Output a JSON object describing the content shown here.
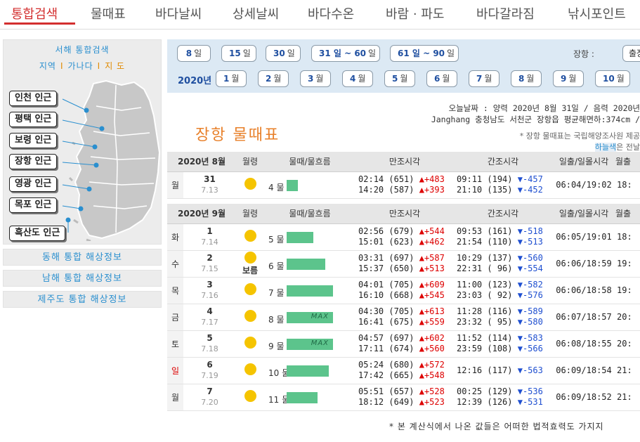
{
  "nav": {
    "tabs": [
      "통합검색",
      "물때표",
      "바다날씨",
      "상세날씨",
      "바다수온",
      "바람 · 파도",
      "바다갈라짐",
      "낚시포인트"
    ]
  },
  "sidebar": {
    "west_title": "서해 통합검색",
    "links": [
      "지역",
      "가나다",
      "지 도"
    ],
    "regions": [
      "인천 인근",
      "평택 인근",
      "보령 인근",
      "장항 인근",
      "영광 인근",
      "목포 인근",
      "흑산도 인근"
    ],
    "other": [
      "동해 통합 해상정보",
      "남해 통합 해상정보",
      "제주도 통합 해상정보"
    ]
  },
  "controls": {
    "ranges": [
      {
        "n": "8",
        "u": "일"
      },
      {
        "n": "15",
        "u": "일"
      },
      {
        "n": "30",
        "u": "일"
      },
      {
        "n": "31 일 ~ 60",
        "u": "일"
      },
      {
        "n": "61 일 ~ 90",
        "u": "일"
      }
    ],
    "year": "2020년",
    "months": [
      {
        "n": "1",
        "u": "월"
      },
      {
        "n": "2",
        "u": "월"
      },
      {
        "n": "3",
        "u": "월"
      },
      {
        "n": "4",
        "u": "월"
      },
      {
        "n": "5",
        "u": "월"
      },
      {
        "n": "6",
        "u": "월"
      },
      {
        "n": "7",
        "u": "월"
      },
      {
        "n": "8",
        "u": "월"
      },
      {
        "n": "9",
        "u": "월"
      },
      {
        "n": "10",
        "u": "월"
      }
    ],
    "port_label": "장항 :",
    "port_value": "출장"
  },
  "info": {
    "date_line": "오늘날짜 : 양력 2020년 8월 31일 / 음력 2020년",
    "place_line": "Janghang 충청남도 서천군 장항읍 평균해면하:374cm /",
    "note1": "* 장항 물때표는 국립해양조사원 제공",
    "note2_hl": "하늘색",
    "note2_rest": "은 전날"
  },
  "title": "장항 물때표",
  "headers": {
    "moon": "월령",
    "flow": "물때/물흐름",
    "high": "만조시각",
    "low": "간조시각",
    "sun": "일출/일몰시각",
    "extra": "월출"
  },
  "aug": {
    "label": "2020년 8월",
    "rows": [
      {
        "dow": "월",
        "day": "31",
        "lunar": "7.13",
        "moon": "",
        "flow": "4 물",
        "bar": 16,
        "max": "",
        "h1": "02:14 (651)",
        "h1d": "▲+483",
        "h2": "14:20 (587)",
        "h2d": "▲+393",
        "l1": "09:11 (194)",
        "l1d": "▼-457",
        "l2": "21:10 (135)",
        "l2d": "▼-452",
        "sun": "06:04/19:02",
        "extra": "18:"
      }
    ]
  },
  "sep": {
    "label": "2020년 9월",
    "rows": [
      {
        "dow": "화",
        "day": "1",
        "lunar": "7.14",
        "moon": "",
        "flow": "5 물",
        "bar": 38,
        "max": "",
        "h1": "02:56 (679)",
        "h1d": "▲+544",
        "h2": "15:01 (623)",
        "h2d": "▲+462",
        "l1": "09:53 (161)",
        "l1d": "▼-518",
        "l2": "21:54 (110)",
        "l2d": "▼-513",
        "sun": "06:05/19:01",
        "extra": "18:"
      },
      {
        "dow": "수",
        "day": "2",
        "lunar": "7.15",
        "moon": "보름",
        "flow": "6 물",
        "bar": 55,
        "max": "",
        "h1": "03:31 (697)",
        "h1d": "▲+587",
        "h2": "15:37 (650)",
        "h2d": "▲+513",
        "l1": "10:29 (137)",
        "l1d": "▼-560",
        "l2": "22:31 ( 96)",
        "l2d": "▼-554",
        "sun": "06:06/18:59",
        "extra": "19:"
      },
      {
        "dow": "목",
        "day": "3",
        "lunar": "7.16",
        "moon": "",
        "flow": "7 물",
        "bar": 66,
        "max": "",
        "h1": "04:01 (705)",
        "h1d": "▲+609",
        "h2": "16:10 (668)",
        "h2d": "▲+545",
        "l1": "11:00 (123)",
        "l1d": "▼-582",
        "l2": "23:03 ( 92)",
        "l2d": "▼-576",
        "sun": "06:06/18:58",
        "extra": "19:"
      },
      {
        "dow": "금",
        "day": "4",
        "lunar": "7.17",
        "moon": "",
        "flow": "8 물",
        "bar": 66,
        "max": "MAX",
        "h1": "04:30 (705)",
        "h1d": "▲+613",
        "h2": "16:41 (675)",
        "h2d": "▲+559",
        "l1": "11:28 (116)",
        "l1d": "▼-589",
        "l2": "23:32 ( 95)",
        "l2d": "▼-580",
        "sun": "06:07/18:57",
        "extra": "20:"
      },
      {
        "dow": "토",
        "day": "5",
        "lunar": "7.18",
        "moon": "",
        "flow": "9 물",
        "bar": 66,
        "max": "MAX",
        "h1": "04:57 (697)",
        "h1d": "▲+602",
        "h2": "17:11 (674)",
        "h2d": "▲+560",
        "l1": "11:52 (114)",
        "l1d": "▼-583",
        "l2": "23:59 (108)",
        "l2d": "▼-566",
        "sun": "06:08/18:55",
        "extra": "20:"
      },
      {
        "dow": "일",
        "day": "6",
        "lunar": "7.19",
        "moon": "",
        "flow": "10 물",
        "bar": 60,
        "max": "",
        "h1": "05:24 (680)",
        "h1d": "▲+572",
        "h2": "17:42 (665)",
        "h2d": "▲+548",
        "l1": "12:16 (117)",
        "l1d": "▼-563",
        "l2": "",
        "l2d": "",
        "sun": "06:09/18:54",
        "extra": "21:"
      },
      {
        "dow": "월",
        "day": "7",
        "lunar": "7.20",
        "moon": "",
        "flow": "11 물",
        "bar": 44,
        "max": "",
        "h1": "05:51 (657)",
        "h1d": "▲+528",
        "h2": "18:12 (649)",
        "h2d": "▲+523",
        "l1": "00:25 (129)",
        "l1d": "▼-536",
        "l2": "12:39 (126)",
        "l2d": "▼-531",
        "sun": "06:09/18:52",
        "extra": "21:"
      }
    ]
  },
  "footer": "* 본 계산식에서 나온 값들은 어떠한 법적효력도 가지지"
}
